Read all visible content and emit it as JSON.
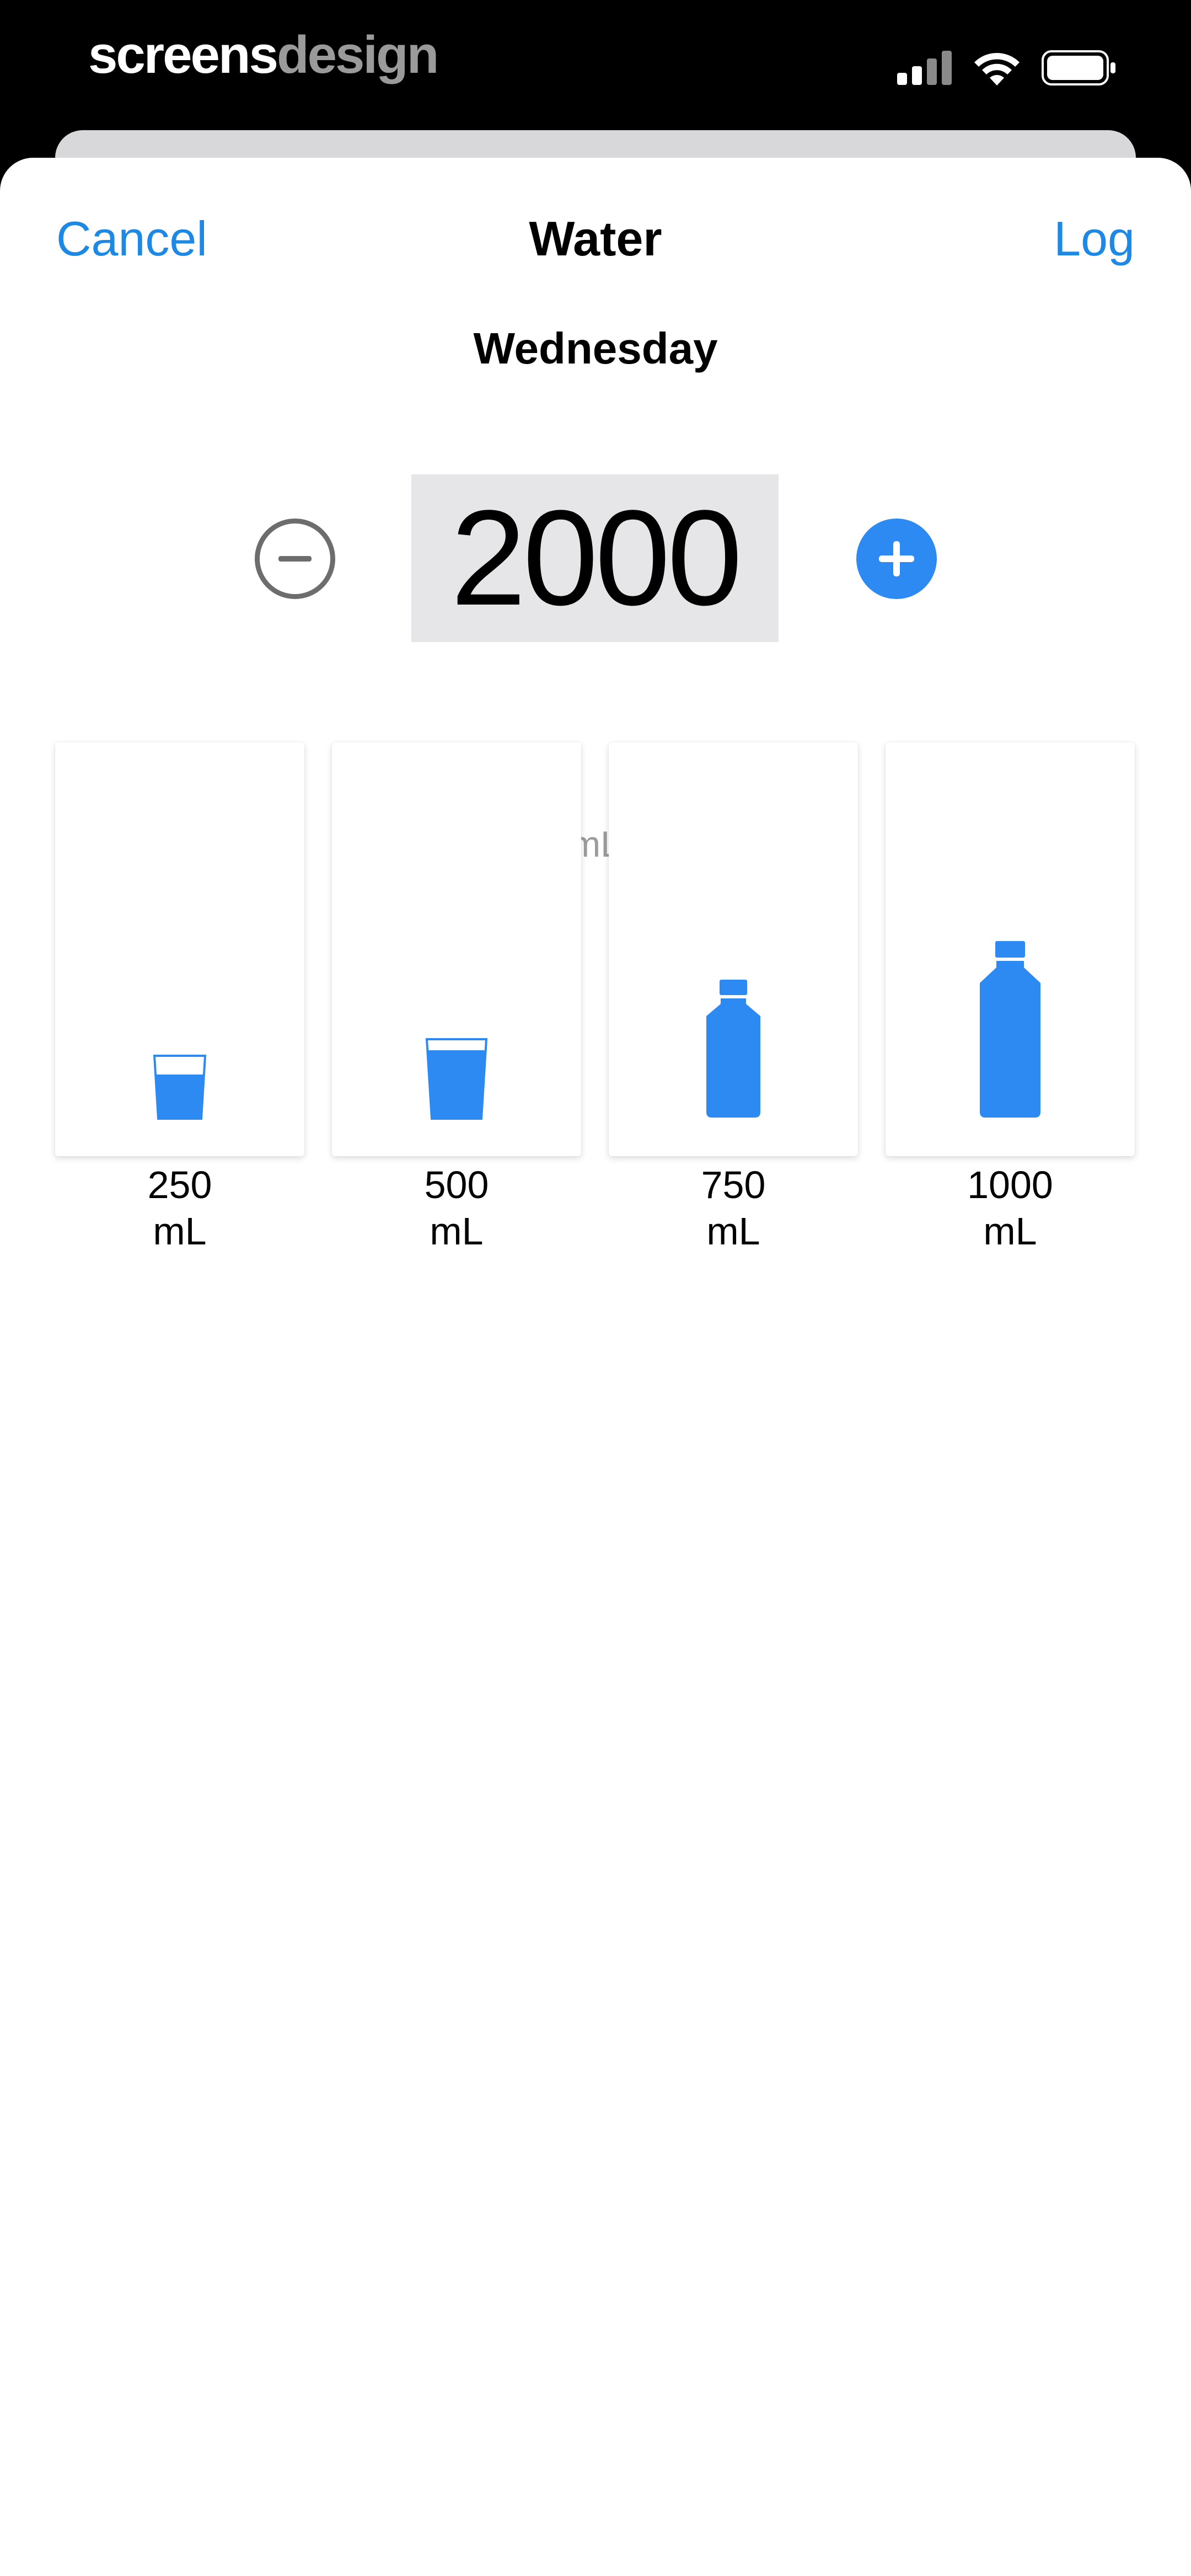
{
  "brand": {
    "part1": "screens",
    "part2": "design"
  },
  "nav": {
    "cancel": "Cancel",
    "title": "Water",
    "log": "Log"
  },
  "day": "Wednesday",
  "amount": {
    "value": "2000",
    "unit": "mL"
  },
  "presets": [
    {
      "amount": "250",
      "unit": "mL",
      "icon": "small-glass-icon"
    },
    {
      "amount": "500",
      "unit": "mL",
      "icon": "large-glass-icon"
    },
    {
      "amount": "750",
      "unit": "mL",
      "icon": "small-bottle-icon"
    },
    {
      "amount": "1000",
      "unit": "mL",
      "icon": "large-bottle-icon"
    }
  ],
  "colors": {
    "accent": "#1e88e5",
    "water_blue": "#2c8af2",
    "field_bg": "#e6e6e9"
  }
}
